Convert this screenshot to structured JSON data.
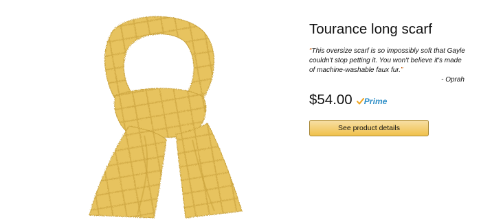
{
  "product": {
    "title": "Tourance long scarf",
    "quote_open": "“",
    "quote_text": "This oversize scarf is so impossibly soft that Gayle couldn't stop petting it. You won't believe it's made of machine-washable faux fur.",
    "quote_close": "”",
    "attribution": "- Oprah",
    "price": "$54.00",
    "prime_label": "Prime",
    "cta_label": "See product details",
    "image_icon": "scarf-photo"
  },
  "colors": {
    "scarf": "#e6c25c",
    "prime_blue": "#2f8fc7",
    "prime_check": "#f0a41c",
    "button_top": "#f7dfa5",
    "button_bottom": "#f0c14b"
  }
}
